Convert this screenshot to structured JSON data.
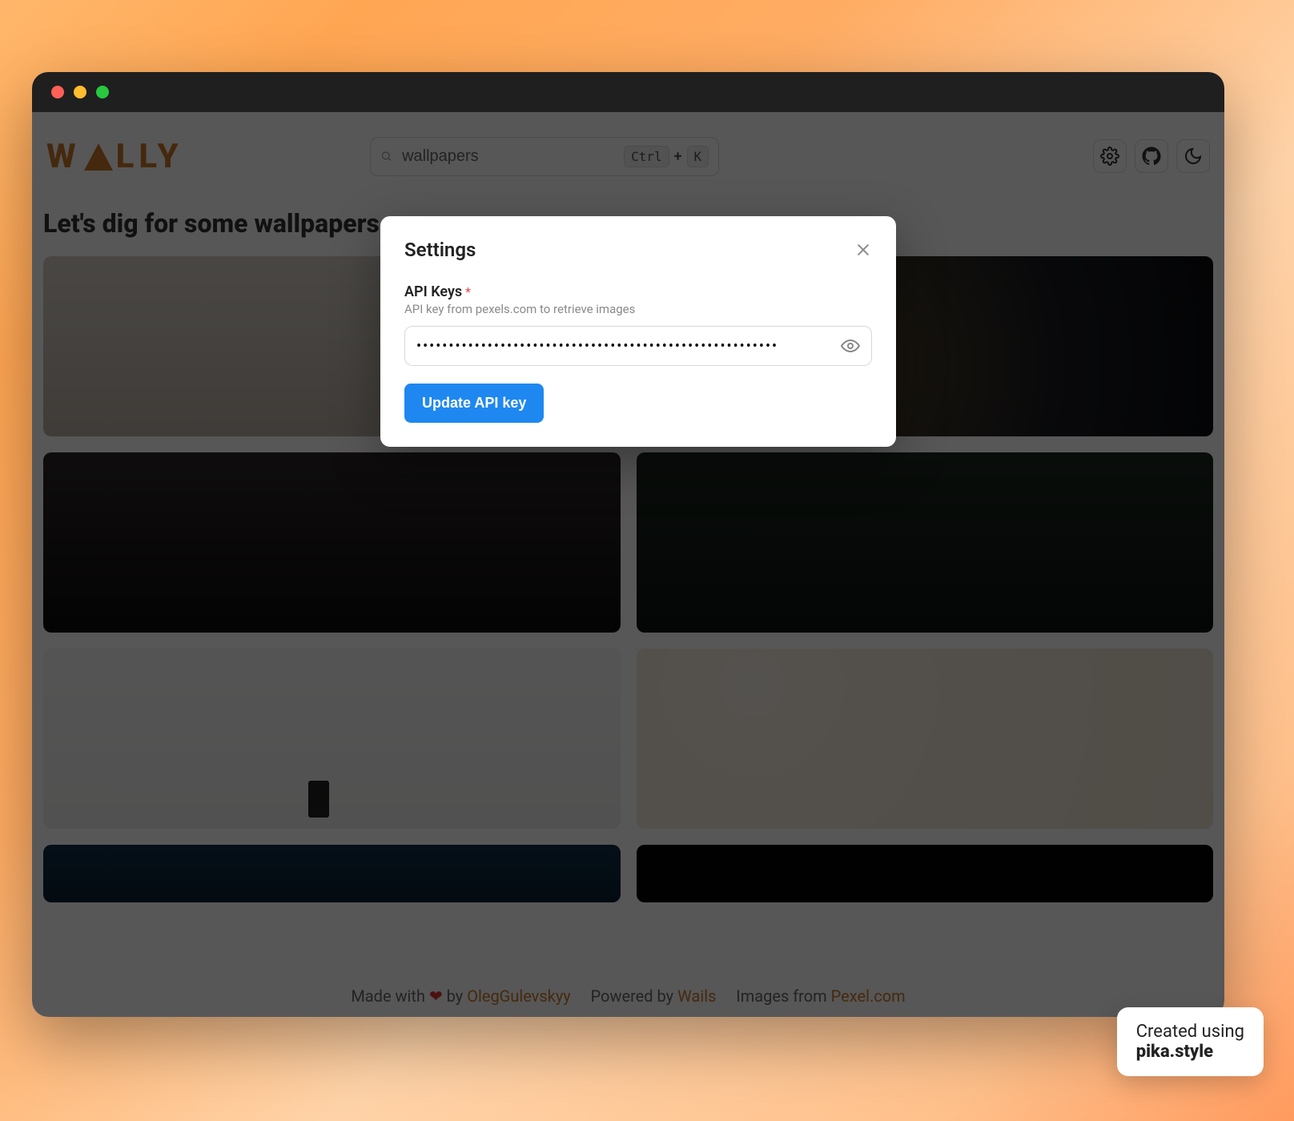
{
  "app": {
    "logo_text": "WALLY"
  },
  "header": {
    "search_value": "wallpapers",
    "kbd_ctrl": "Ctrl",
    "kbd_plus": "+",
    "kbd_k": "K"
  },
  "heading": "Let's dig for some wallpapers",
  "modal": {
    "title": "Settings",
    "label": "API Keys",
    "required_mark": "*",
    "help": "API key from pexels.com to retrieve images",
    "input_value": "••••••••••••••••••••••••••••••••••••••••••••••••••••••••",
    "button": "Update API key"
  },
  "footer": {
    "made_with": "Made with ",
    "heart": "❤",
    "by": " by ",
    "author": "OlegGulevskyy",
    "powered_by": "Powered by ",
    "powered_link": "Wails",
    "images_from": "Images from ",
    "images_link": "Pexel.com"
  },
  "badge": {
    "line1": "Created using",
    "line2": "pika.style"
  }
}
